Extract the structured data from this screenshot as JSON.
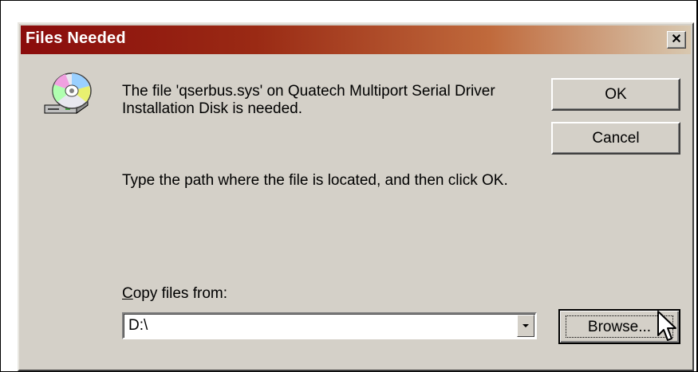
{
  "window": {
    "title": "Files Needed",
    "close_glyph": "✕"
  },
  "message": {
    "line1": "The file 'qserbus.sys' on Quatech Multiport Serial Driver Installation Disk is needed.",
    "line2": "Type the path where the file is located, and then click OK."
  },
  "buttons": {
    "ok_label": "OK",
    "cancel_label": "Cancel",
    "browse_label": "Browse..."
  },
  "copy_from": {
    "label_prefix": "C",
    "label_rest": "opy files from:",
    "value": "D:\\"
  },
  "icons": {
    "dialog_icon": "cd-drive-icon",
    "pointer": "mouse-pointer-icon"
  },
  "colors": {
    "titlebar_start": "#8a0c0c",
    "titlebar_end": "#d8c8b0",
    "dialog_face": "#d4d0c8"
  }
}
